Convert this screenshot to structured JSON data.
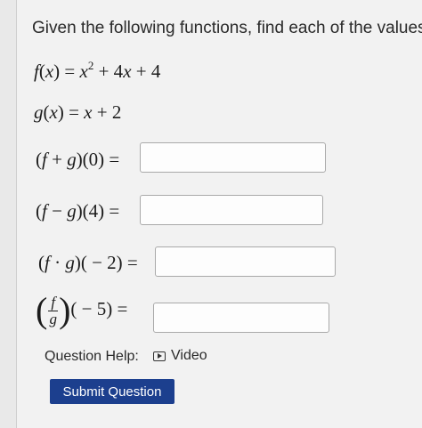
{
  "question": {
    "prompt": "Given the following functions, find each of the values:",
    "f_def": {
      "name": "f",
      "var": "x",
      "rhs_a": "x",
      "rhs_exp": "2",
      "rhs_b": " + 4",
      "rhs_c": "x",
      "rhs_d": " + 4"
    },
    "g_def": {
      "name": "g",
      "var": "x",
      "rhs_a": "x",
      "rhs_b": " + 2"
    }
  },
  "parts": [
    {
      "lhs_open": "(",
      "f": "f",
      "op": " + ",
      "g": "g",
      "rest": ")(0) =",
      "value": ""
    },
    {
      "lhs_open": "(",
      "f": "f",
      "op": " − ",
      "g": "g",
      "rest": ")(4) =",
      "value": ""
    },
    {
      "lhs_open": "(",
      "f": "f",
      "op": " · ",
      "g": "g",
      "rest": ")( − 2) =",
      "value": ""
    },
    {
      "num": "f",
      "den": "g",
      "rest": "( − 5) =",
      "value": ""
    }
  ],
  "help": {
    "label": "Question Help:",
    "video_label": "Video",
    "video_icon": "play-video-icon"
  },
  "submit_label": "Submit Question"
}
